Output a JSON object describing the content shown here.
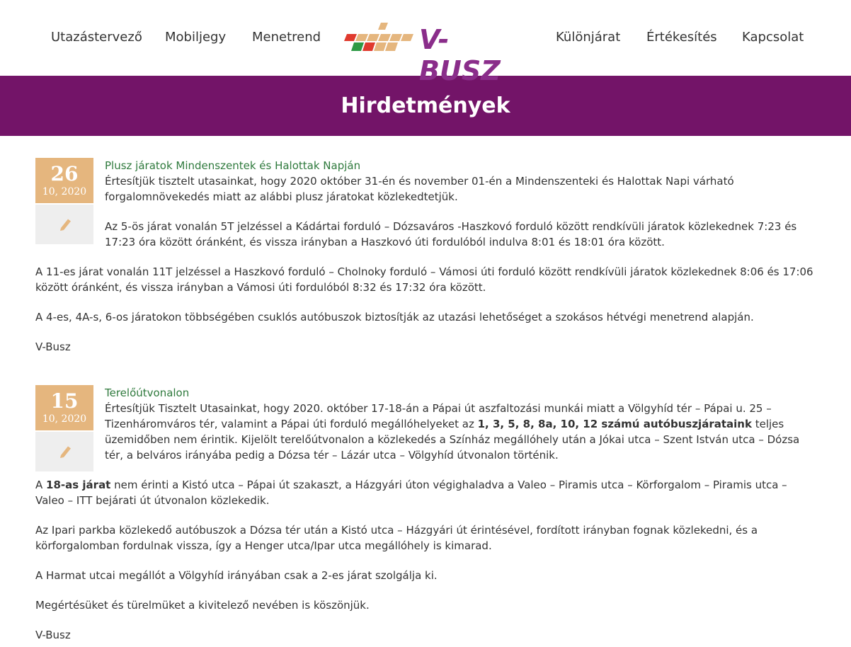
{
  "nav": {
    "left": [
      "Utazástervező",
      "Mobiljegy",
      "Menetrend"
    ],
    "right": [
      "Különjárat",
      "Értékesítés",
      "Kapcsolat"
    ],
    "logo_text": "V-BUSZ"
  },
  "banner": {
    "title": "Hirdetmények"
  },
  "posts": [
    {
      "day": "26",
      "month_year": "10, 2020",
      "title": "Plusz járatok Mindenszentek és Halottak Napján",
      "p1": "Értesítjük tisztelt utasainkat, hogy 2020 október 31-én és november 01-én a Mindenszenteki és Halottak Napi várható forgalomnövekedés miatt az alábbi plusz járatokat közlekedtetjük.",
      "p2": "Az 5-ös járat vonalán 5T jelzéssel a Kádártai forduló – Dózsaváros -Haszkovó forduló között rendkívüli járatok közlekednek 7:23 és 17:23 óra között óránként, és vissza irányban a Haszkovó úti fordulóból indulva 8:01 és 18:01 óra között.",
      "p3": "A 11-es járat vonalán 11T jelzéssel a Haszkovó forduló – Cholnoky forduló – Vámosi úti forduló között rendkívüli járatok közlekednek 8:06 és 17:06 között óránként, és vissza irányban a Vámosi úti fordulóból 8:32 és 17:32 óra között.",
      "p4": "A 4-es, 4A-s, 6-os járatokon többségében csuklós autóbuszok biztosítják az utazási lehetőséget a szokásos hétvégi menetrend alapján.",
      "p5": "V-Busz"
    },
    {
      "day": "15",
      "month_year": "10, 2020",
      "title": "Terelőútvonalon",
      "p1a": "Értesítjük Tisztelt Utasainkat, hogy 2020. október 17-18-án a Pápai út aszfaltozási munkái miatt a Völgyhíd tér – Pápai u. 25 – Tizenháromváros tér, valamint a Pápai úti forduló megállóhelyeket az ",
      "p1b": "1, 3, 5, 8, 8a, 10, 12 számú autóbuszjárataink",
      "p1c": " teljes üzemidőben nem érintik. Kijelölt terelőútvonalon a közlekedés a Színház megállóhely után a Jókai utca – Szent István utca – Dózsa tér, a belváros irányába pedig a Dózsa tér – Lázár utca – Völgyhíd útvonalon történik.",
      "p2a": "A ",
      "p2b": "18-as járat",
      "p2c": " nem érinti a Kistó utca – Pápai út szakaszt, a Házgyári úton végighaladva a Valeo – Piramis utca – Körforgalom – Piramis utca – Valeo – ITT bejárati út útvonalon közlekedik.",
      "p3": "Az Ipari parkba közlekedő autóbuszok a Dózsa tér után a Kistó utca – Házgyári út érintésével, fordított irányban fognak közlekedni, és a körforgalomban fordulnak vissza, így a Henger utca/Ipar utca megállóhely is kimarad.",
      "p4": "A Harmat utcai megállót a Völgyhíd irányában csak a 2-es járat szolgálja ki.",
      "p5": "Megértésüket és türelmüket a kivitelező nevében is köszönjük.",
      "p6": "V-Busz"
    }
  ],
  "colors": {
    "banner": "#731468",
    "date_box": "#e5b67e",
    "title_green": "#2f7a3d",
    "logo_purple": "#8a2d8a"
  },
  "icons": [
    "pencil-icon"
  ]
}
